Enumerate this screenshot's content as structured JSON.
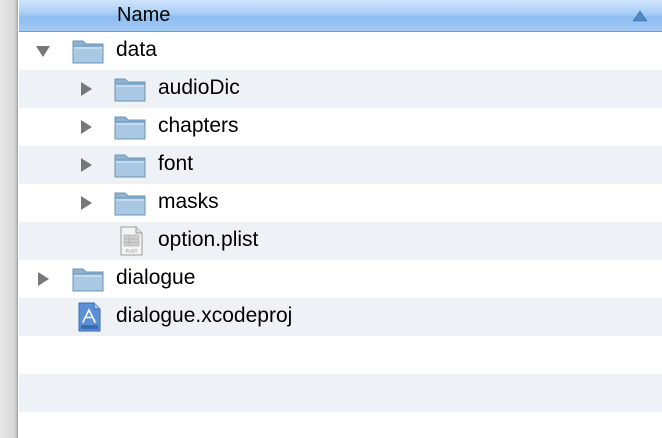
{
  "header": {
    "column_label": "Name",
    "sort_direction": "ascending",
    "colors": {
      "header_top": "#cfe4fb",
      "header_bottom": "#8dbdf2",
      "row_alt": "#eef2f7"
    }
  },
  "rows": [
    {
      "label": "data",
      "kind": "folder",
      "expanded": true,
      "icon": "folder-icon"
    },
    {
      "label": "audioDic",
      "kind": "folder",
      "expanded": false,
      "icon": "folder-icon"
    },
    {
      "label": "chapters",
      "kind": "folder",
      "expanded": false,
      "icon": "folder-icon"
    },
    {
      "label": "font",
      "kind": "folder",
      "expanded": false,
      "icon": "folder-icon"
    },
    {
      "label": "masks",
      "kind": "folder",
      "expanded": false,
      "icon": "folder-icon"
    },
    {
      "label": "option.plist",
      "kind": "file",
      "icon": "plist-file-icon",
      "icon_text": "PLIST"
    },
    {
      "label": "dialogue",
      "kind": "folder",
      "expanded": false,
      "icon": "folder-icon"
    },
    {
      "label": "dialogue.xcodeproj",
      "kind": "file",
      "icon": "xcodeproj-file-icon"
    }
  ]
}
